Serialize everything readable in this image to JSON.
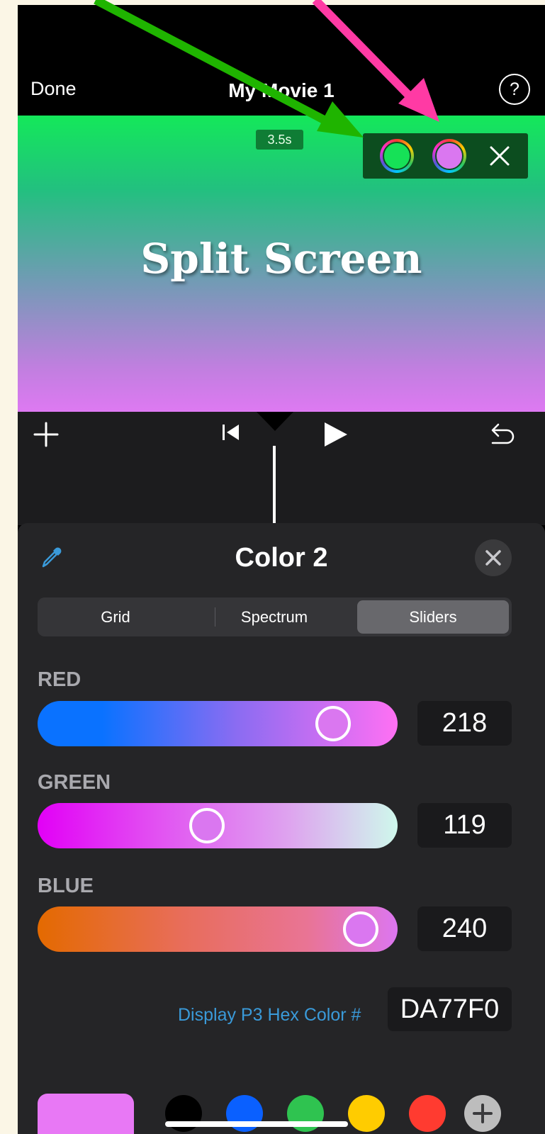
{
  "nav": {
    "done_label": "Done",
    "title": "My Movie 1",
    "help_glyph": "?"
  },
  "preview": {
    "duration": "3.5s",
    "title_text": "Split Screen",
    "gradient_colors": [
      "#14e85a",
      "#de79f2"
    ],
    "color1_swatch": "#16e157",
    "color2_swatch": "#da77f0"
  },
  "timeline": {
    "icons": [
      "add-icon",
      "skip-to-start-icon",
      "play-icon",
      "undo-icon"
    ]
  },
  "picker": {
    "title": "Color 2",
    "tabs": [
      {
        "label": "Grid",
        "selected": false
      },
      {
        "label": "Spectrum",
        "selected": false
      },
      {
        "label": "Sliders",
        "selected": true
      }
    ],
    "sliders": [
      {
        "label": "RED",
        "value": "218",
        "fraction": 0.855
      },
      {
        "label": "GREEN",
        "value": "119",
        "fraction": 0.467
      },
      {
        "label": "BLUE",
        "value": "240",
        "fraction": 0.941
      }
    ],
    "hex_label": "Display P3 Hex Color #",
    "hex_value": "DA77F0",
    "current_color": "#e878f5",
    "presets": [
      "#000000",
      "#0a60ff",
      "#2fc350",
      "#ffcc00",
      "#ff3b30"
    ]
  },
  "annotations": {
    "arrow_colors": [
      "#1fb400",
      "#ff3aa4"
    ]
  }
}
